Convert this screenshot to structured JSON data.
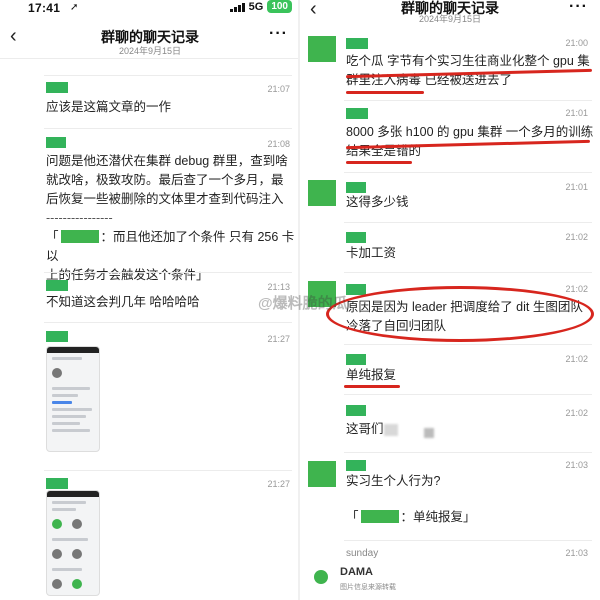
{
  "status_bar": {
    "time": "17:41",
    "location_glyph": "➚",
    "network": "5G",
    "battery": "100"
  },
  "left": {
    "header": {
      "back": "‹",
      "title": "群聊的聊天记录",
      "date": "2024年9月15日",
      "more": "···"
    },
    "messages": [
      {
        "time": "21:07",
        "text": "应该是这篇文章的一作"
      },
      {
        "time": "21:08",
        "lines": [
          "问题是他还潜伏在集群 debug 群里，查到啥",
          "就改啥，极致攻防。最后查了一个多月，最",
          "后恢复一些被删除的文体里才查到代码注入",
          "----------------"
        ],
        "quote_prefix": "「",
        "quote_line1_suffix": "：而且他还加了个条件 只有 256 卡以",
        "quote_line2": "上的任务才会触发这个条件」"
      },
      {
        "time": "21:13",
        "text": "不知道这会判几年 哈哈哈哈"
      },
      {
        "time": "21:27"
      },
      {
        "time": "21:27"
      }
    ]
  },
  "right": {
    "header": {
      "back": "‹",
      "title": "群聊的聊天记录",
      "date": "2024年9月15日",
      "more": "···"
    },
    "messages": [
      {
        "time": "21:00",
        "lines": [
          "吃个瓜 字节有个实习生往商业化整个 gpu 集",
          "群里注入病毒 已经被送进去了"
        ]
      },
      {
        "time": "21:01",
        "lines": [
          "8000 多张 h100 的 gpu 集群 一个多月的训练",
          "结果全是错的"
        ]
      },
      {
        "time": "21:01",
        "text": "这得多少钱"
      },
      {
        "time": "21:02",
        "text": "卡加工资"
      },
      {
        "time": "21:02",
        "lines": [
          "原因是因为 leader 把调度给了 dit 生图团队",
          "冷落了自回归团队"
        ]
      },
      {
        "time": "21:02",
        "text": "单纯报复"
      },
      {
        "time": "21:02",
        "text": "这哥们"
      },
      {
        "time": "21:03",
        "text": "实习生个人行为?",
        "quote_prefix": "「",
        "quote_suffix": "：单纯报复」"
      },
      {
        "time": "21:03",
        "name": "sunday"
      }
    ]
  },
  "watermark": "@爆料脆的瓜",
  "brand": {
    "name": "DAMA",
    "sub": "图片信息来源转载"
  },
  "colors": {
    "avatar": "#3fb44e",
    "highlight": "#d7261e",
    "battery": "#3ac35b"
  }
}
